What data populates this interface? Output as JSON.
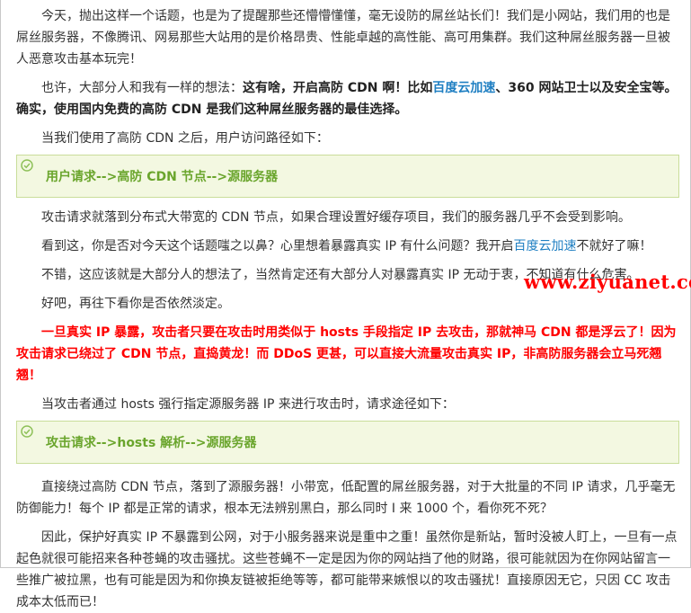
{
  "article": {
    "p1": "今天，抛出这样一个话题，也是为了提醒那些还懵懵懂懂，毫无设防的屌丝站长们！我们是小网站，我们用的也是屌丝服务器，不像腾讯、网易那些大站用的是价格昂贵、性能卓越的高性能、高可用集群。我们这种屌丝服务器一旦被人恶意攻击基本玩完！",
    "p2_a": "也许，大部分人和我有一样的想法：",
    "p2_b": "这有啥，开启高防 CDN 啊！比如",
    "p2_link": "百度云加速",
    "p2_c": "、360 网站卫士以及安全宝等。确实，使用国内免费的高防 CDN 是我们这种屌丝服务器的最佳选择。",
    "p3": "当我们使用了高防 CDN 之后，用户访问路径如下：",
    "callout1": "用户请求-->高防 CDN 节点-->源服务器",
    "p4": "攻击请求就落到分布式大带宽的 CDN 节点，如果合理设置好缓存项目，我们的服务器几乎不会受到影响。",
    "p5_a": "看到这，你是否对今天这个话题嗤之以鼻？心里想着暴露真实 IP 有什么问题？我开启",
    "p5_link": "百度云加速",
    "p5_b": "不就好了嘛！",
    "p6": "不错，这应该就是大部分人的想法了，当然肯定还有大部分人对暴露真实 IP 无动于衷，不知道有什么危害。",
    "p7": "好吧，再往下看你是否依然淡定。",
    "watermark": "www.ziyuanet.com",
    "p8": "一旦真实 IP 暴露，攻击者只要在攻击时用类似于 hosts 手段指定 IP 去攻击，那就神马 CDN 都是浮云了！因为攻击请求已绕过了 CDN 节点，直捣黄龙！而 DDoS 更甚，可以直接大流量攻击真实 IP，非高防服务器会立马死翘翘！",
    "p9": "当攻击者通过 hosts 强行指定源服务器 IP 来进行攻击时，请求途径如下：",
    "callout2": "攻击请求-->hosts 解析-->源服务器",
    "p10": "直接绕过高防 CDN 节点，落到了源服务器！小带宽，低配置的屌丝服务器，对于大批量的不同 IP 请求，几乎毫无防御能力！每个 IP 都是正常的请求，根本无法辨别黑白，那么同时 I 来 1000 个，看你死不死？",
    "p11": "因此，保护好真实 IP 不暴露到公网，对于小服务器来说是重中之重！虽然你是新站，暂时没被人盯上，一旦有一点起色就很可能招来各种苍蝇的攻击骚扰。这些苍蝇不一定是因为你的网站挡了他的财路，很可能就因为在你网站留言一些推广被拉黑，也有可能是因为和你换友链被拒绝等等，都可能带来嫉恨以的攻击骚扰！直接原因无它，只因 CC 攻击成本太低而已！"
  },
  "colors": {
    "link": "#1f7fc2",
    "warning": "#ff0000",
    "callout_bg": "#f3f8e1",
    "callout_text": "#6aa52c"
  },
  "icons": {
    "callout": "check-circle-icon"
  }
}
